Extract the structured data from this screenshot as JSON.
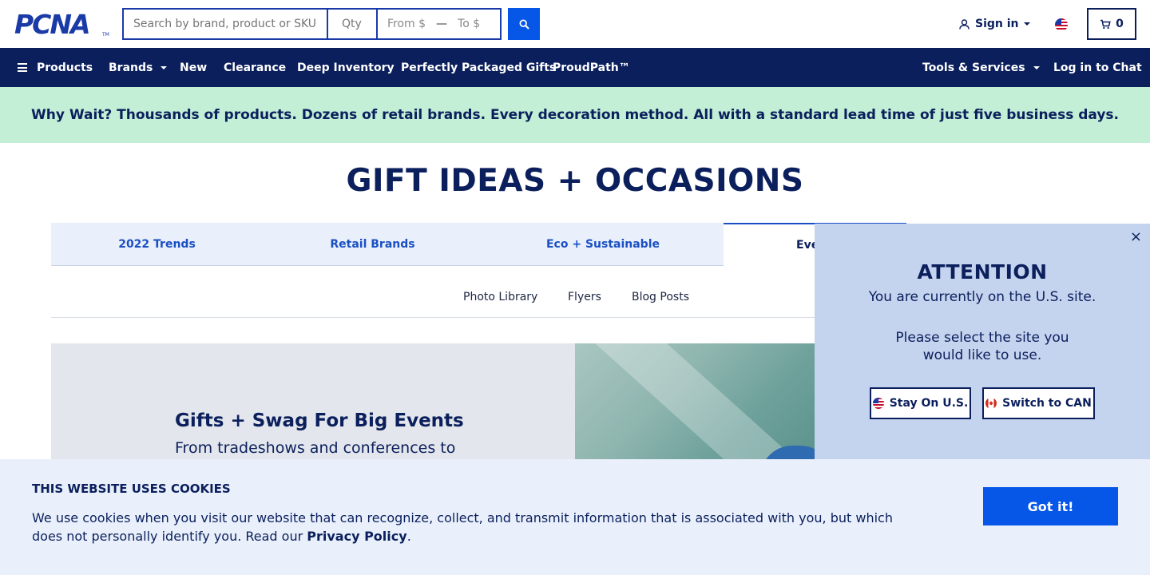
{
  "header": {
    "logo": "PCNA",
    "logo_tm": "TM",
    "search_placeholder": "Search by brand, product or SKU",
    "qty_placeholder": "Qty",
    "price_from": "From $",
    "price_dash": "—",
    "price_to": "To $",
    "signin_label": "Sign in",
    "cart_count": "0"
  },
  "nav": {
    "items": [
      "Products",
      "Brands",
      "New",
      "Clearance",
      "Deep Inventory",
      "Perfectly Packaged Gifts",
      "ProudPath™"
    ],
    "tools_label": "Tools & Services",
    "chat_label": "Log in to Chat"
  },
  "promo": {
    "text": "Why Wait? Thousands of products. Dozens of retail brands. Every decoration method. All with a standard lead time of just five business days."
  },
  "page": {
    "title": "GIFT IDEAS + OCCASIONS"
  },
  "tabs": [
    "2022 Trends",
    "Retail Brands",
    "Eco + Sustainable",
    "Eve"
  ],
  "subnav": [
    "Photo Library",
    "Flyers",
    "Blog Posts"
  ],
  "hero": {
    "title": "Gifts + Swag For Big Events",
    "subtitle": "From tradeshows and conferences to"
  },
  "attention": {
    "close": "×",
    "title": "ATTENTION",
    "message": "You are currently on the U.S. site.",
    "prompt": "Please select the site you would like to use.",
    "stay_label": "Stay On U.S.",
    "switch_label": "Switch to CAN"
  },
  "cookies": {
    "title": "THIS WEBSITE USES COOKIES",
    "text": "We use cookies when you visit our website that can recognize, collect, and transmit information that is associated with you, but which does not personally identify you. Read our ",
    "link": "Privacy Policy",
    "end": ".",
    "button": "Got it!"
  },
  "colors": {
    "navy": "#0b1f5c",
    "brand_blue": "#0656e8",
    "promo_bg": "#c2efd6",
    "tab_bg": "#e9f0fb",
    "popup_bg": "#c4d3ee"
  }
}
